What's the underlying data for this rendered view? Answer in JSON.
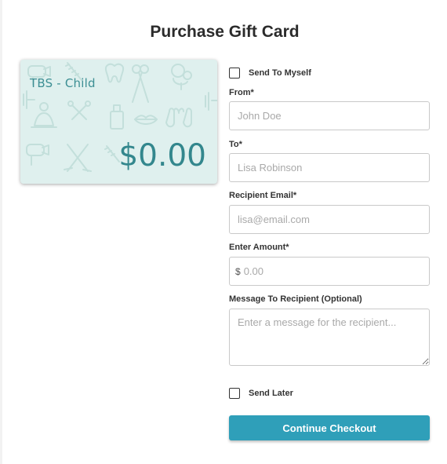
{
  "page": {
    "title": "Purchase Gift Card"
  },
  "card": {
    "name": "TBS - Child",
    "amount": "$0.00",
    "background_color": "#dff0ee",
    "text_color": "#33878d",
    "pattern_icons": [
      "hair-dryer-icon",
      "comb-icon",
      "tooth-icon",
      "scissors-icon",
      "poodle-icon",
      "dumbbell-icon",
      "buddha-icon",
      "tools-icon",
      "bottle-icon",
      "lips-icon",
      "hands-icon",
      "broom-icon"
    ]
  },
  "form": {
    "send_to_myself_label": "Send To Myself",
    "send_to_myself_checked": false,
    "from": {
      "label": "From*",
      "value": "",
      "placeholder": "John Doe"
    },
    "to": {
      "label": "To*",
      "value": "",
      "placeholder": "Lisa Robinson"
    },
    "email": {
      "label": "Recipient Email*",
      "value": "",
      "placeholder": "lisa@email.com"
    },
    "amount": {
      "label": "Enter Amount*",
      "currency": "$",
      "value": "",
      "placeholder": "0.00"
    },
    "message": {
      "label": "Message To Recipient (Optional)",
      "value": "",
      "placeholder": "Enter a message for the recipient..."
    },
    "send_later_label": "Send Later",
    "send_later_checked": false,
    "checkout_label": "Continue Checkout",
    "accent_color": "#2f9fb9"
  }
}
